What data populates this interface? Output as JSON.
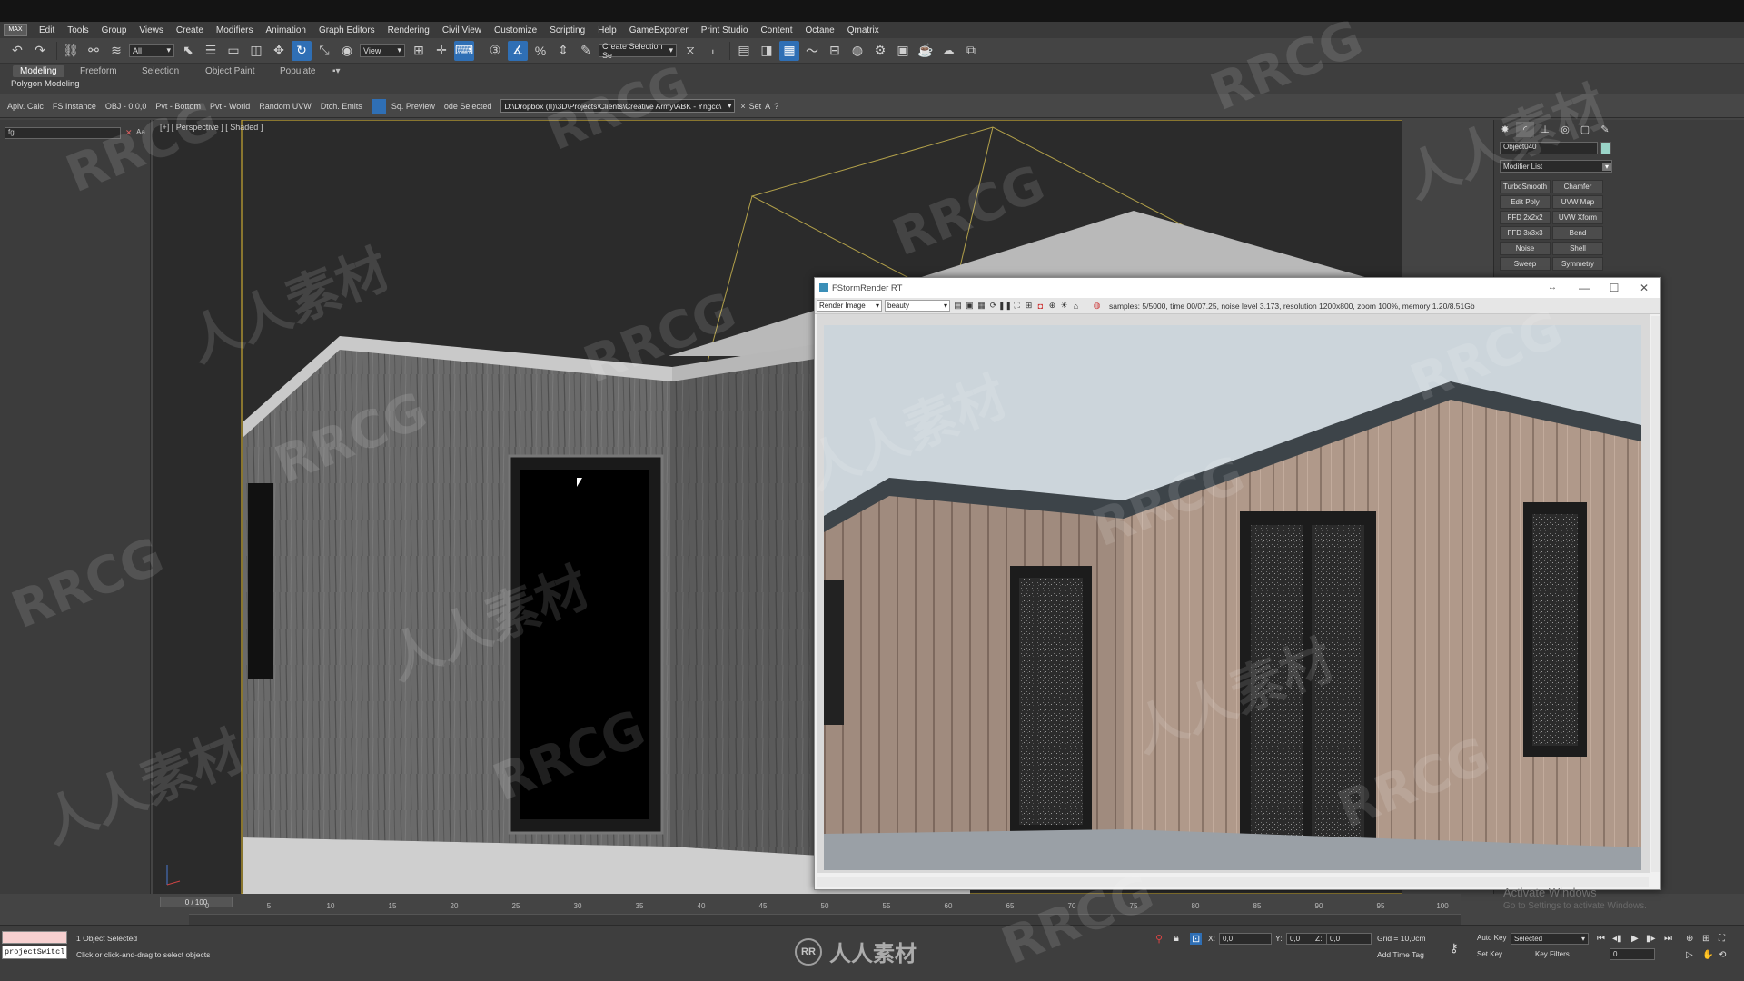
{
  "app": {
    "logo_text": "MAX"
  },
  "menu": [
    "Edit",
    "Tools",
    "Group",
    "Views",
    "Create",
    "Modifiers",
    "Animation",
    "Graph Editors",
    "Rendering",
    "Civil View",
    "Customize",
    "Scripting",
    "Help",
    "GameExporter",
    "Print Studio",
    "Content",
    "Octane",
    "Qmatrix"
  ],
  "toolbar": {
    "filter_combo": "All",
    "refcoord_combo": "View",
    "selection_set_combo": "Create Selection Se"
  },
  "ribbon": {
    "tabs": [
      "Modeling",
      "Freeform",
      "Selection",
      "Object Paint",
      "Populate"
    ],
    "sub_label": "Polygon Modeling"
  },
  "ribbon_sub": {
    "items": [
      "Apiv. Calc",
      "FS Instance",
      "OBJ - 0,0,0",
      "Pvt - Bottom",
      "Pvt - World",
      "Random UVW",
      "Dtch. Emlts",
      "Sq. Preview",
      "ode Selected"
    ],
    "path": "D:\\Dropbox (II)\\3D\\Projects\\Clients\\Creative Army\\ABK - Yngcc\\",
    "set_label": "Set",
    "a_label": "A",
    "q_label": "?"
  },
  "scene_explorer": {
    "search_value": "fg"
  },
  "viewport": {
    "label": "[+] [ Perspective ] [ Shaded ]"
  },
  "command_panel": {
    "object_name": "Object040",
    "modifier_list": "Modifier List",
    "modifiers": [
      "TurboSmooth",
      "Chamfer",
      "Edit Poly",
      "UVW Map",
      "FFD 2x2x2",
      "UVW Xform",
      "FFD 3x3x3",
      "Bend",
      "Noise",
      "Shell",
      "Sweep",
      "Symmetry"
    ],
    "colors": {
      "object_color": "#9ad4c8"
    }
  },
  "fstorm": {
    "title": "FStormRender RT",
    "render_combo": "Render Image",
    "pass_combo": "beauty",
    "stats": "samples: 5/5000, time 00/07.25, noise level 3.173, resolution 1200x800, zoom 100%, memory 1.20/8.51Gb"
  },
  "timeline": {
    "slider": "0 / 100",
    "ticks": [
      "0",
      "5",
      "10",
      "15",
      "20",
      "25",
      "30",
      "35",
      "40",
      "45",
      "50",
      "55",
      "60",
      "65",
      "70",
      "75",
      "80",
      "85",
      "90",
      "95",
      "100"
    ]
  },
  "status": {
    "maxscript": "projectSwitcl",
    "selection": "1 Object Selected",
    "prompt": "Click or click-and-drag to select objects",
    "x_label": "X:",
    "x": "0,0",
    "y_label": "Y:",
    "y": "0,0",
    "z_label": "Z:",
    "z": "0,0",
    "grid": "Grid = 10,0cm",
    "add_time_tag": "Add Time Tag",
    "auto_key": "Auto Key",
    "selected_combo": "Selected",
    "set_key": "Set Key",
    "key_filters": "Key Filters...",
    "frame": "0"
  },
  "activate_windows": {
    "title": "Activate Windows",
    "subtitle": "Go to Settings to activate Windows."
  },
  "watermarks": [
    "RRCG",
    "人人素材"
  ],
  "bottom_logo": {
    "badge": "RR",
    "text": "人人素材"
  }
}
